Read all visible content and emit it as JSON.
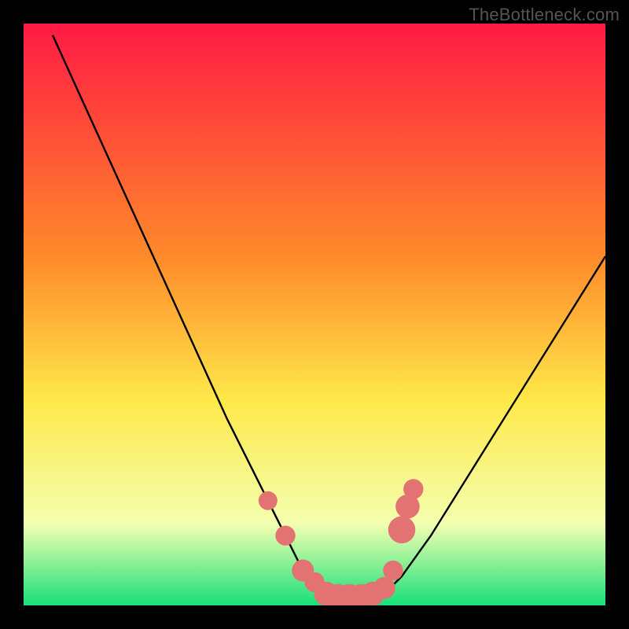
{
  "watermark": "TheBottleneck.com",
  "colors": {
    "gradient_top": "#ff1a44",
    "gradient_mid1": "#ff8a2a",
    "gradient_mid2": "#ffe94a",
    "gradient_mid3": "#f3ffb0",
    "gradient_bottom": "#18e07a",
    "curve": "#000000",
    "marker": "#e37373",
    "frame": "#000000"
  },
  "chart_data": {
    "type": "line",
    "title": "",
    "xlabel": "",
    "ylabel": "",
    "xlim": [
      0,
      100
    ],
    "ylim": [
      0,
      100
    ],
    "series": [
      {
        "name": "curve",
        "x": [
          5,
          10,
          15,
          20,
          25,
          30,
          35,
          40,
          42,
          45,
          48,
          52,
          55,
          58,
          60,
          62,
          65,
          70,
          75,
          80,
          85,
          90,
          95,
          100
        ],
        "y": [
          98,
          87,
          76,
          65,
          54,
          43,
          32,
          22,
          18,
          12,
          6,
          3,
          1,
          1,
          1,
          2,
          5,
          12,
          20,
          28,
          36,
          44,
          52,
          60
        ]
      }
    ],
    "markers": [
      {
        "x": 42,
        "y": 18,
        "r": 1.2
      },
      {
        "x": 45,
        "y": 12,
        "r": 1.3
      },
      {
        "x": 48,
        "y": 6,
        "r": 1.5
      },
      {
        "x": 50,
        "y": 4,
        "r": 1.3
      },
      {
        "x": 52,
        "y": 2,
        "r": 1.7
      },
      {
        "x": 54,
        "y": 1.5,
        "r": 1.8
      },
      {
        "x": 56,
        "y": 1.5,
        "r": 1.8
      },
      {
        "x": 58,
        "y": 1.5,
        "r": 1.8
      },
      {
        "x": 60,
        "y": 2,
        "r": 1.7
      },
      {
        "x": 62,
        "y": 3,
        "r": 1.5
      },
      {
        "x": 63.5,
        "y": 6,
        "r": 1.3
      },
      {
        "x": 65,
        "y": 13,
        "r": 2.0
      },
      {
        "x": 66,
        "y": 17,
        "r": 1.7
      },
      {
        "x": 67,
        "y": 20,
        "r": 1.3
      }
    ]
  }
}
